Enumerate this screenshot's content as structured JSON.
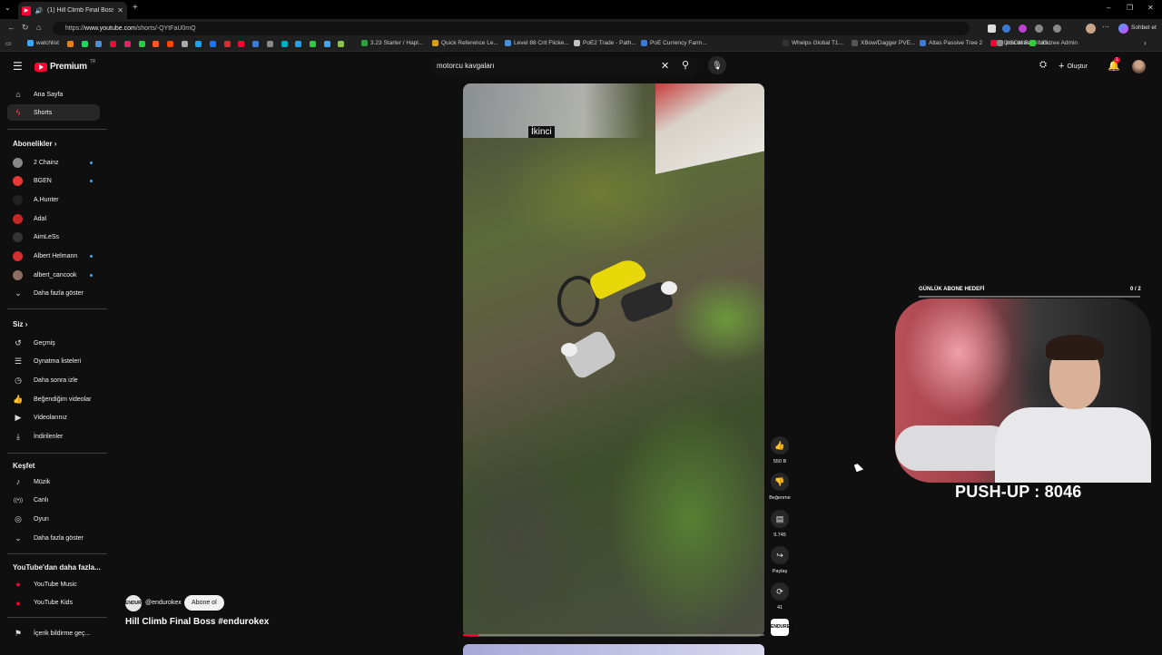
{
  "browser": {
    "tab_title": "(1) Hill Climb Final Boss #endu",
    "url_prefix": "https://",
    "url_host": "www.youtube.com",
    "url_path": "/shorts/-QYtFaU0mQ",
    "chat_label": "Sohbet et",
    "bookmarks": [
      {
        "label": "watchlist",
        "color": "#3ea6ff"
      },
      {
        "label": "3.23 Starter / Hapl...",
        "color": "#2e9e44"
      },
      {
        "label": "Quick Reference Le...",
        "color": "#d4a017"
      },
      {
        "label": "Level 88 Crit Flicke...",
        "color": "#4a90d9"
      },
      {
        "label": "PoE2 Trade - Path...",
        "color": "#c0c0c0"
      },
      {
        "label": "PoE Currency Farm...",
        "color": "#3b7bd4"
      },
      {
        "label": "Whelps Global T1...",
        "color": "#333333"
      },
      {
        "label": "XBow/Dagger PVE...",
        "color": "#555555"
      },
      {
        "label": "Atlas Passive Tree 2",
        "color": "#3b7bd4"
      },
      {
        "label": "POISON RAGING...",
        "color": "#ff0033"
      },
      {
        "label": "poe atlas",
        "color": "#888888"
      },
      {
        "label": "Linktree Admin",
        "color": "#2ecc40"
      }
    ]
  },
  "header": {
    "logo_text": "Premium",
    "logo_region": "TR",
    "search_query": "motorcu kavgaları",
    "create_label": "Oluştur",
    "notification_count": "1"
  },
  "sidebar": {
    "home": "Ana Sayfa",
    "shorts": "Shorts",
    "subscriptions_header": "Abonelikler",
    "subscriptions": [
      {
        "name": "2 Chainz",
        "color": "#888888",
        "dot": true
      },
      {
        "name": "BGEN",
        "color": "#e53935",
        "dot": true
      },
      {
        "name": "A.Hunter",
        "color": "#222222",
        "dot": false
      },
      {
        "name": "Adal",
        "color": "#c62828",
        "dot": false
      },
      {
        "name": "AimLeSs",
        "color": "#333333",
        "dot": false
      },
      {
        "name": "Albert Helmann",
        "color": "#d32f2f",
        "dot": true
      },
      {
        "name": "albert_cancook",
        "color": "#8d6e63",
        "dot": true
      }
    ],
    "show_more": "Daha fazla göster",
    "you_header": "Siz",
    "you_items": [
      "Geçmiş",
      "Oynatma listeleri",
      "Daha sonra izle",
      "Beğendiğim videolar",
      "Videolarınız",
      "İndirilenler"
    ],
    "explore_header": "Keşfet",
    "explore_items": [
      "Müzik",
      "Canlı",
      "Oyun"
    ],
    "show_more_2": "Daha fazla göster",
    "more_header": "YouTube'dan daha fazla...",
    "more_items": [
      "YouTube Music",
      "YouTube Kids"
    ],
    "report": "İçerik bildirme geç..."
  },
  "short": {
    "caption": "İkinci",
    "channel": "@endurokex",
    "channel_avatar": "ENDUREX",
    "subscribe": "Abone ol",
    "title": "Hill Climb Final Boss #endurokex",
    "progress": 0.05,
    "actions": {
      "like_count": "550 B",
      "dislike_label": "Beğenme",
      "comment_count": "9.745",
      "share_label": "Paylaş",
      "remix_count": "41"
    }
  },
  "overlay": {
    "goal_label": "GÜNLÜK ABONE HEDEFİ",
    "goal_count": "0 / 2",
    "pushup": "PUSH-UP : 8046"
  },
  "colors": {
    "accent": "#ff0033",
    "background": "#0f0f0f",
    "link_blue": "#3ea6ff"
  }
}
